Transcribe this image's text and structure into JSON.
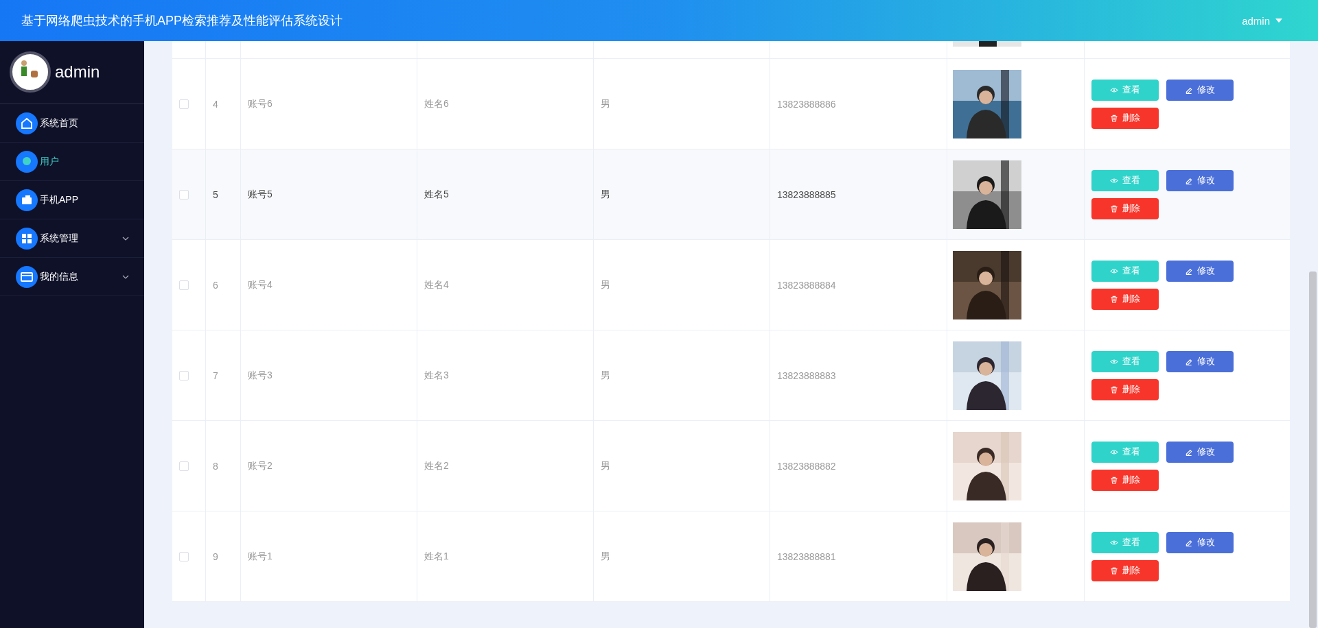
{
  "header": {
    "title": "基于网络爬虫技术的手机APP检索推荐及性能评估系统设计",
    "user": "admin"
  },
  "sidebar": {
    "user": "admin",
    "menu": [
      {
        "label": "系统首页",
        "kind": "home",
        "selected": false,
        "expandable": false
      },
      {
        "label": "用户",
        "kind": "user",
        "selected": true,
        "expandable": false
      },
      {
        "label": "手机APP",
        "kind": "app",
        "selected": false,
        "expandable": false
      },
      {
        "label": "系统管理",
        "kind": "grid",
        "selected": false,
        "expandable": true
      },
      {
        "label": "我的信息",
        "kind": "card",
        "selected": false,
        "expandable": true
      }
    ]
  },
  "table": {
    "rows": [
      {
        "index": "4",
        "account": "账号6",
        "name": "姓名6",
        "gender": "男",
        "phone": "13823888886",
        "checked": false,
        "highlighted": false,
        "buttons": [
          {
            "kind": "view",
            "label": "查看"
          },
          {
            "kind": "edit",
            "label": "修改"
          },
          {
            "kind": "delete",
            "label": "删除"
          }
        ]
      },
      {
        "index": "5",
        "account": "账号5",
        "name": "姓名5",
        "gender": "男",
        "phone": "13823888885",
        "checked": false,
        "highlighted": true,
        "buttons": [
          {
            "kind": "view",
            "label": "查看"
          },
          {
            "kind": "edit",
            "label": "修改"
          },
          {
            "kind": "delete",
            "label": "删除"
          }
        ]
      },
      {
        "index": "6",
        "account": "账号4",
        "name": "姓名4",
        "gender": "男",
        "phone": "13823888884",
        "checked": false,
        "highlighted": false,
        "buttons": [
          {
            "kind": "view",
            "label": "查看"
          },
          {
            "kind": "edit",
            "label": "修改"
          },
          {
            "kind": "delete",
            "label": "删除"
          }
        ]
      },
      {
        "index": "7",
        "account": "账号3",
        "name": "姓名3",
        "gender": "男",
        "phone": "13823888883",
        "checked": false,
        "highlighted": false,
        "buttons": [
          {
            "kind": "view",
            "label": "查看"
          },
          {
            "kind": "edit",
            "label": "修改"
          },
          {
            "kind": "delete",
            "label": "删除"
          }
        ]
      },
      {
        "index": "8",
        "account": "账号2",
        "name": "姓名2",
        "gender": "男",
        "phone": "13823888882",
        "checked": false,
        "highlighted": false,
        "buttons": [
          {
            "kind": "view",
            "label": "查看"
          },
          {
            "kind": "edit",
            "label": "修改"
          },
          {
            "kind": "delete",
            "label": "删除"
          }
        ]
      },
      {
        "index": "9",
        "account": "账号1",
        "name": "姓名1",
        "gender": "男",
        "phone": "13823888881",
        "checked": false,
        "highlighted": false,
        "buttons": [
          {
            "kind": "view",
            "label": "查看"
          },
          {
            "kind": "edit",
            "label": "修改"
          },
          {
            "kind": "delete",
            "label": "删除"
          }
        ]
      }
    ]
  }
}
